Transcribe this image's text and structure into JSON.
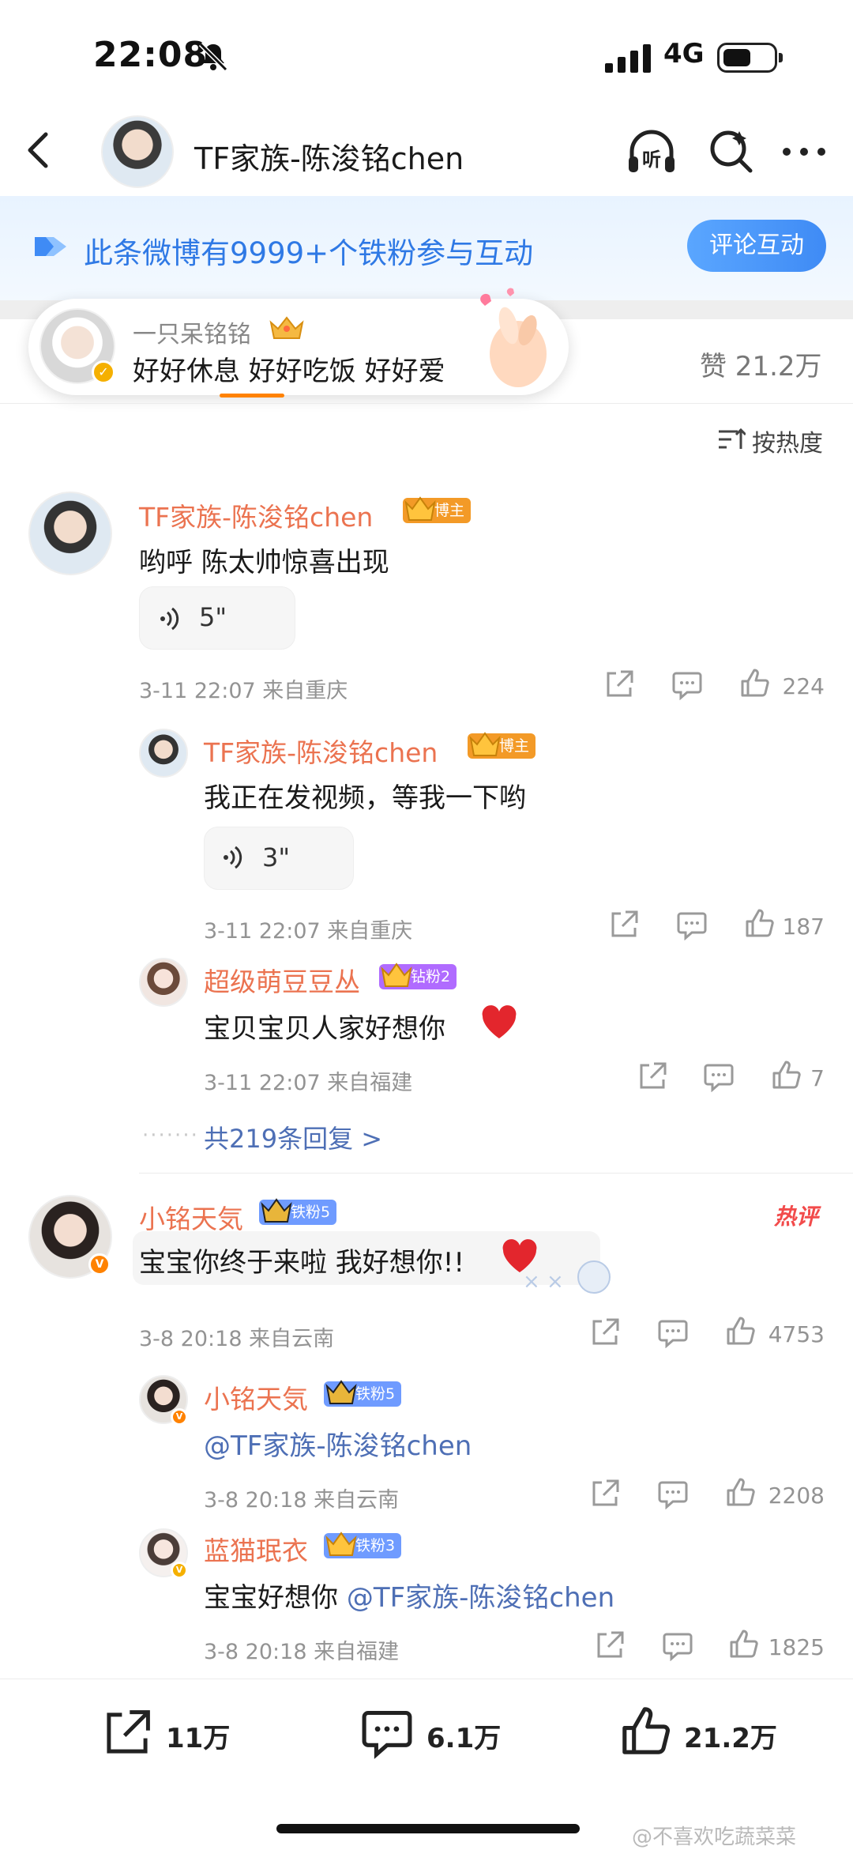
{
  "status_bar": {
    "time": "22:08",
    "network": "4G"
  },
  "nav": {
    "title": "TF家族-陈浚铭chen",
    "listen_label": "听"
  },
  "fan_banner": {
    "text": "此条微博有9999+个铁粉参与互动",
    "button": "评论互动"
  },
  "bubble": {
    "name": "一只呆铭铭",
    "message": "好好休息 好好吃饭 好好爱"
  },
  "likes_total": "赞 21.2万",
  "sort_label": "按热度",
  "comments": [
    {
      "name": "TF家族-陈浚铭chen",
      "badge": "博主",
      "text": "哟呼 陈太帅惊喜出现",
      "voice": "5\"",
      "meta": "3-11 22:07  来自重庆",
      "likes": "224",
      "replies": [
        {
          "name": "TF家族-陈浚铭chen",
          "badge": "博主",
          "text": "我正在发视频，等我一下哟",
          "voice": "3\"",
          "meta": "3-11 22:07  来自重庆",
          "likes": "187"
        },
        {
          "name": "超级萌豆豆丛",
          "badge": "钻粉2",
          "text": "宝贝宝贝人家好想你",
          "meta": "3-11 22:07  来自福建",
          "likes": "7"
        }
      ],
      "reply_all": "共219条回复 >"
    },
    {
      "name": "小铭天気",
      "badge": "铁粉5",
      "hot_tag": "热评",
      "text": "宝宝你终于来啦 我好想你!!",
      "meta": "3-8 20:18  来自云南",
      "likes": "4753",
      "replies": [
        {
          "name": "小铭天気",
          "badge": "铁粉5",
          "text": "@TF家族-陈浚铭chen",
          "meta": "3-8 20:18  来自云南",
          "likes": "2208"
        },
        {
          "name": "蓝猫珉衣",
          "badge": "铁粉3",
          "text_prefix": "宝宝好想你 ",
          "text_mention": "@TF家族-陈浚铭chen",
          "meta": "3-8 20:18  来自福建",
          "likes": "1825"
        }
      ]
    }
  ],
  "bottom_bar": {
    "share": "11万",
    "comment": "6.1万",
    "like": "21.2万"
  },
  "watermark": "@不喜欢吃蔬菜菜",
  "colors": {
    "name": "#eb7350",
    "link": "#4e6fb5",
    "accent": "#ff8200",
    "blue": "#2f79e5"
  }
}
